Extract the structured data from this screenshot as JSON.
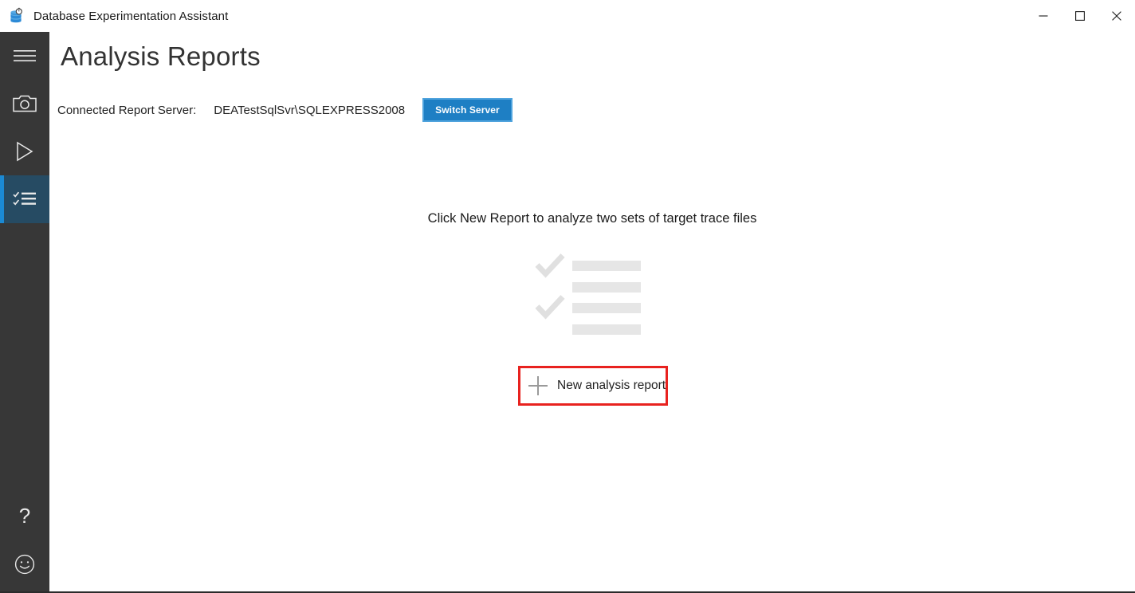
{
  "window": {
    "title": "Database Experimentation Assistant",
    "app_icon": "database-stopwatch-icon",
    "controls": {
      "minimize": "minimize-icon",
      "maximize": "maximize-icon",
      "close": "close-icon"
    }
  },
  "sidebar": {
    "items": [
      {
        "id": "menu",
        "icon": "hamburger-menu-icon",
        "selected": false
      },
      {
        "id": "capture",
        "icon": "camera-icon",
        "selected": false
      },
      {
        "id": "replay",
        "icon": "play-icon",
        "selected": false
      },
      {
        "id": "reports",
        "icon": "checklist-icon",
        "selected": true
      }
    ],
    "bottom_items": [
      {
        "id": "help",
        "icon": "question-mark-icon"
      },
      {
        "id": "feedback",
        "icon": "smiley-face-icon"
      }
    ],
    "accent_color": "#1b8ad4",
    "selected_background": "#264b63",
    "background": "#373737"
  },
  "main": {
    "page_title": "Analysis Reports",
    "server": {
      "label": "Connected Report Server:",
      "value": "DEATestSqlSvr\\SQLEXPRESS2008",
      "switch_button_label": "Switch Server",
      "switch_button_color": "#1e7fc4"
    },
    "empty_state": {
      "hint": "Click New Report to analyze two sets of target trace files",
      "placeholder_icon": "checklist-placeholder-icon",
      "placeholder_checkmark_count": 2,
      "placeholder_bar_count": 4,
      "placeholder_color": "#e6e6e6"
    },
    "new_report": {
      "label": "New analysis report",
      "icon": "plus-icon",
      "highlight_color": "#e8221f"
    }
  }
}
